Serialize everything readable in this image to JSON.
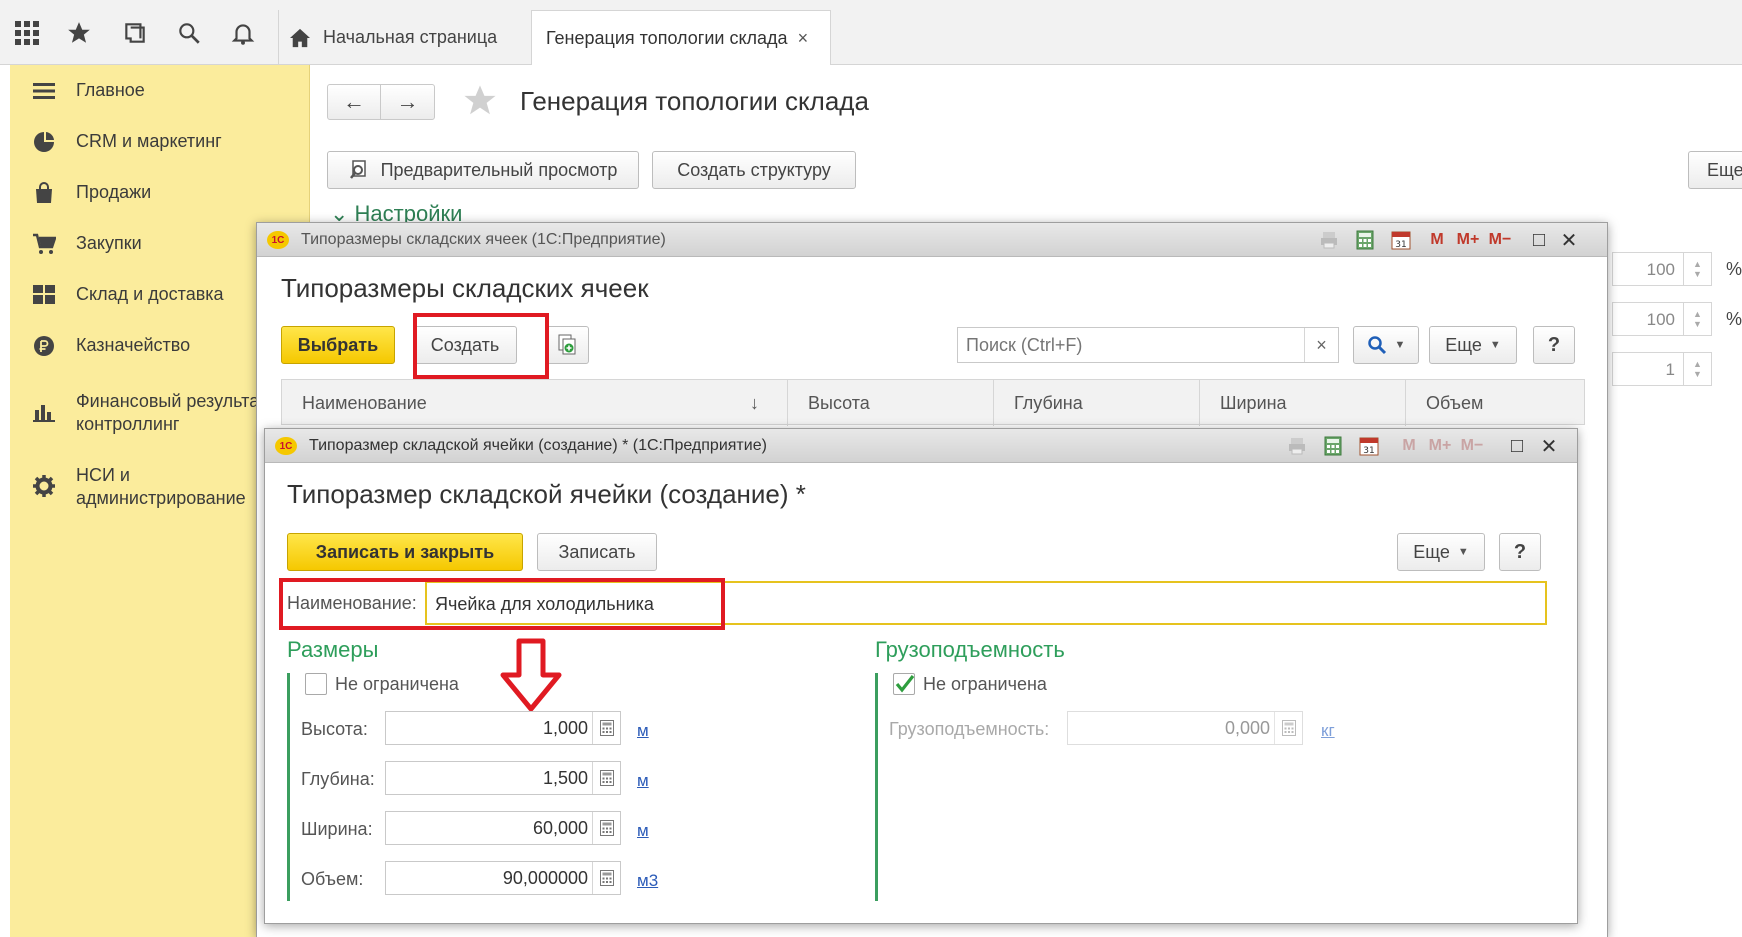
{
  "topbar": {
    "icons": [
      "apps-grid-icon",
      "star-icon",
      "history-icon",
      "search-icon",
      "bell-icon"
    ],
    "tabs": [
      {
        "label": "Начальная страница",
        "icon": "home-icon"
      },
      {
        "label": "Генерация топологии склада",
        "close": "×"
      }
    ]
  },
  "sidebar": {
    "items": [
      {
        "label": "Главное",
        "icon": "menu-icon"
      },
      {
        "label": "CRM и маркетинг",
        "icon": "pie-chart-icon"
      },
      {
        "label": "Продажи",
        "icon": "shopping-bag-icon"
      },
      {
        "label": "Закупки",
        "icon": "cart-icon"
      },
      {
        "label": "Склад и доставка",
        "icon": "warehouse-icon"
      },
      {
        "label": "Казначейство",
        "icon": "ruble-coin-icon"
      },
      {
        "label": "Финансовый результат и",
        "label2": "контроллинг",
        "icon": "bar-chart-icon"
      },
      {
        "label": "НСИ и",
        "label2": "администрирование",
        "icon": "gear-icon"
      }
    ]
  },
  "main": {
    "nav_back": "←",
    "nav_forward": "→",
    "title": "Генерация топологии склада",
    "preview_btn": "Предварительный просмотр",
    "create_structure_btn": "Создать структуру",
    "more_btn": "Еще",
    "settings": "Настройки",
    "right_inputs": [
      {
        "value": "100",
        "suffix": "%"
      },
      {
        "value": "100",
        "suffix": "%"
      },
      {
        "value": "1",
        "suffix": ""
      }
    ]
  },
  "list_window": {
    "caption": "Типоразмеры складских ячеек  (1С:Предприятие)",
    "logo": "1С",
    "title": "Типоразмеры складских ячеек",
    "select_btn": "Выбрать",
    "create_btn": "Создать",
    "search_placeholder": "Поиск (Ctrl+F)",
    "search_clear": "×",
    "more_btn": "Еще",
    "help_btn": "?",
    "title_controls": [
      "M",
      "M+",
      "M−",
      "□",
      "✕"
    ],
    "columns": [
      "Наименование",
      "Высота",
      "Глубина",
      "Ширина",
      "Объем"
    ],
    "sort_indicator": "↓"
  },
  "item_window": {
    "caption": "Типоразмер складской ячейки (создание) * (1С:Предприятие)",
    "logo": "1С",
    "title": "Типоразмер складской ячейки (создание) *",
    "save_close_btn": "Записать и закрыть",
    "save_btn": "Записать",
    "more_btn": "Еще",
    "help_btn": "?",
    "title_controls": [
      "M",
      "M+",
      "M−",
      "□",
      "✕"
    ],
    "name_label": "Наименование:",
    "name_value": "Ячейка для холодильника",
    "sizes": {
      "header": "Размеры",
      "unlimited_label": "Не ограничена",
      "unlimited_checked": false,
      "fields": [
        {
          "label": "Высота:",
          "value": "1,000",
          "unit": "м"
        },
        {
          "label": "Глубина:",
          "value": "1,500",
          "unit": "м"
        },
        {
          "label": "Ширина:",
          "value": "60,000",
          "unit": "м"
        },
        {
          "label": "Объем:",
          "value": "90,000000",
          "unit": "м3"
        }
      ]
    },
    "capacity": {
      "header": "Грузоподъемность",
      "unlimited_label": "Не ограничена",
      "unlimited_checked": true,
      "field_label": "Грузоподъемность:",
      "field_value": "0,000",
      "unit": "кг"
    }
  },
  "colors": {
    "sidebar_bg": "#fbec9c",
    "accent_yellow": "#f5c800",
    "group_green": "#2e9e5b",
    "highlight_red": "#e01a22",
    "link_blue": "#2b5bb8"
  }
}
